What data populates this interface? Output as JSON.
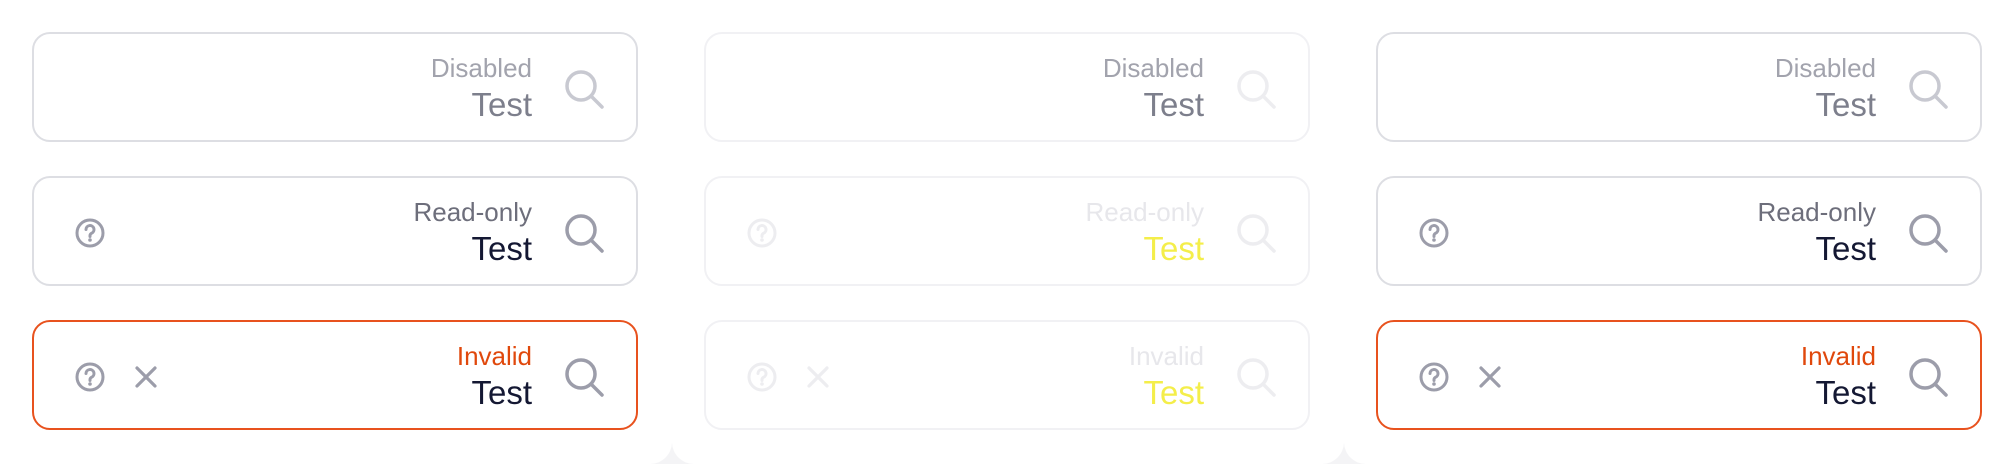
{
  "fields": [
    {
      "label": "Disabled",
      "value": "Test"
    },
    {
      "label": "Read-only",
      "value": "Test"
    },
    {
      "label": "Invalid",
      "value": "Test"
    }
  ],
  "icons": {
    "search": "search-icon",
    "help": "help-circle-icon",
    "clear": "close-icon"
  },
  "colors": {
    "border": "#dddee3",
    "invalid": "#e0480c",
    "text": "#141833",
    "muted": "#6d6e7b",
    "icon": "#9c9daa",
    "faded_highlight": "#f4ee4a"
  }
}
